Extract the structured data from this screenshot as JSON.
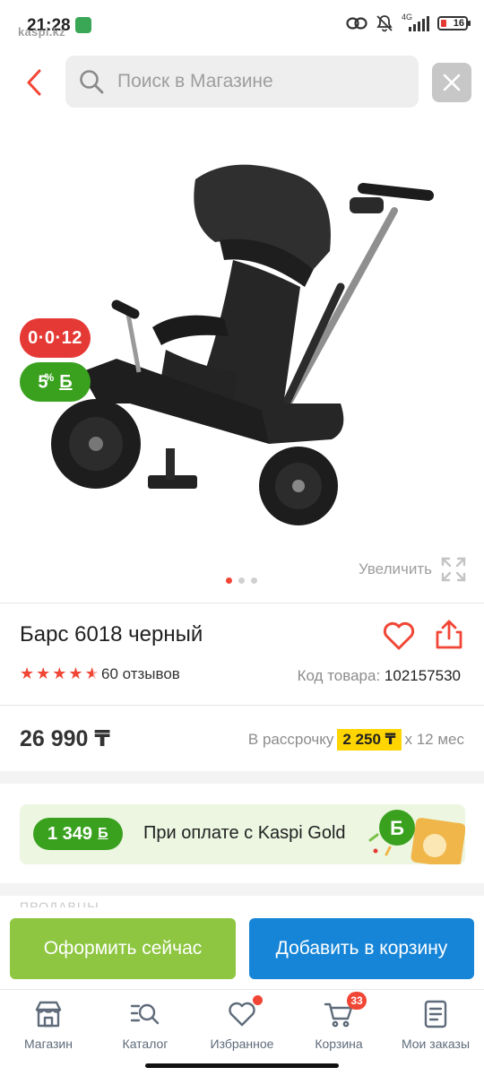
{
  "status_bar": {
    "time": "21:28",
    "brand": "kaspi.kz",
    "network": "4G",
    "battery": "16"
  },
  "search": {
    "placeholder": "Поиск в Магазине"
  },
  "product": {
    "badge_installment": "0·0·12",
    "badge_bonus_value": "5",
    "badge_bonus_percent": "%",
    "badge_bonus_currency": "Б",
    "zoom_label": "Увеличить",
    "title": "Барс 6018 черный",
    "rating": 4.5,
    "reviews": "60 отзывов",
    "code_label": "Код товара:",
    "code_value": "102157530",
    "price": "26 990 ₸",
    "installment_prefix": "В рассрочку",
    "installment_amount": "2 250 ₸",
    "installment_suffix": "х 12 мес",
    "image_count": 3,
    "image_active": 1
  },
  "gold_banner": {
    "bonus": "1 349",
    "bonus_currency": "Б",
    "text": "При оплате с Kaspi Gold"
  },
  "section_label": "ПРОДАВЦЫ",
  "actions": {
    "buy_label": "Оформить сейчас",
    "cart_label": "Добавить в корзину"
  },
  "nav": {
    "items": [
      {
        "label": "Магазин"
      },
      {
        "label": "Каталог"
      },
      {
        "label": "Избранное"
      },
      {
        "label": "Корзина",
        "badge": "33"
      },
      {
        "label": "Мои заказы"
      }
    ]
  },
  "colors": {
    "accent_red": "#f14635",
    "bonus_green": "#3aa11f",
    "buy_green": "#8ec641",
    "cart_blue": "#1685d8",
    "installment_yellow": "#ffd500"
  }
}
